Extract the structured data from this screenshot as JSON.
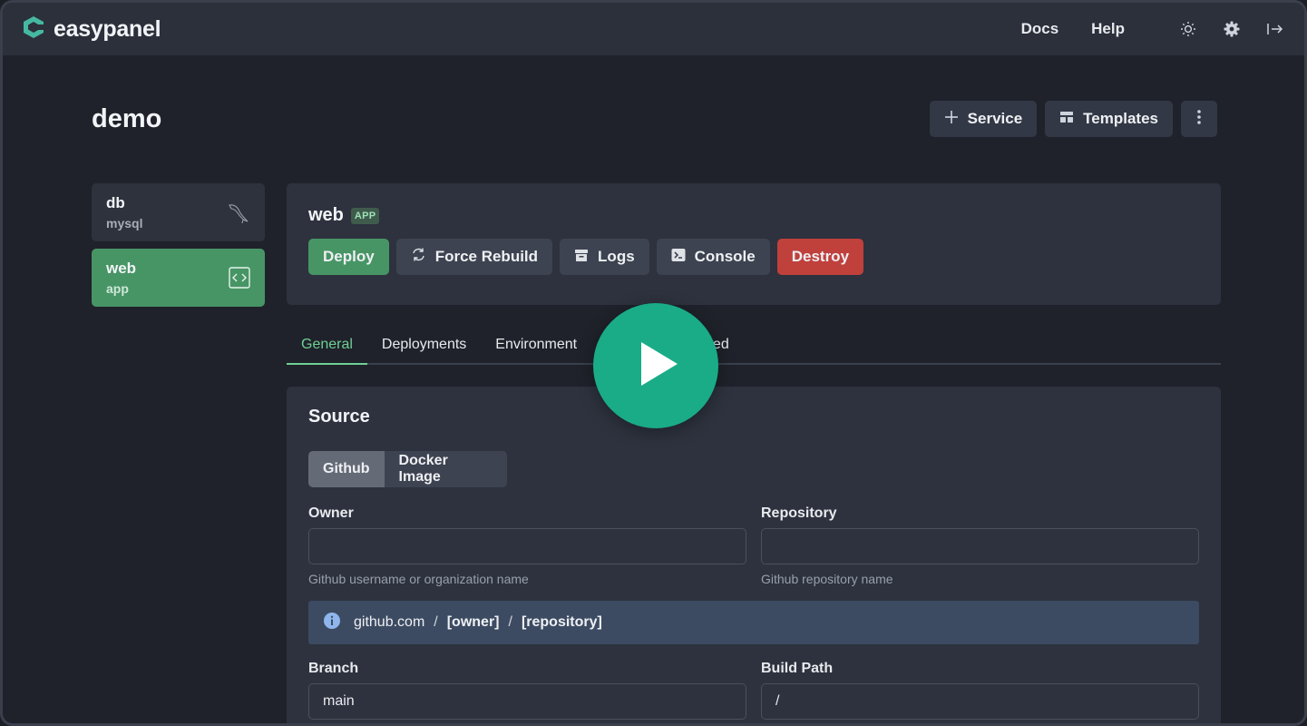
{
  "brand": {
    "name": "easypanel"
  },
  "topnav": {
    "docs": "Docs",
    "help": "Help"
  },
  "project": {
    "title": "demo"
  },
  "header_actions": {
    "service": "Service",
    "templates": "Templates"
  },
  "services": [
    {
      "name": "db",
      "type": "mysql"
    },
    {
      "name": "web",
      "type": "app"
    }
  ],
  "service_panel": {
    "name": "web",
    "badge": "APP",
    "actions": {
      "deploy": "Deploy",
      "force_rebuild": "Force Rebuild",
      "logs": "Logs",
      "console": "Console",
      "destroy": "Destroy"
    }
  },
  "tabs": [
    "General",
    "Deployments",
    "Environment",
    "vanced"
  ],
  "source": {
    "title": "Source",
    "options": [
      "Github",
      "Docker Image"
    ],
    "owner": {
      "label": "Owner",
      "value": "",
      "hint": "Github username or organization name"
    },
    "repository": {
      "label": "Repository",
      "value": "",
      "hint": "Github repository name"
    },
    "info": {
      "domain": "github.com",
      "owner": "[owner]",
      "repository": "[repository]",
      "sep": "/"
    },
    "branch": {
      "label": "Branch",
      "value": "main"
    },
    "build_path": {
      "label": "Build Path",
      "value": "/"
    }
  },
  "colors": {
    "accent": "#479565",
    "destroy": "#c0403c",
    "play": "#19ac87",
    "brand": "#46b8a2"
  }
}
